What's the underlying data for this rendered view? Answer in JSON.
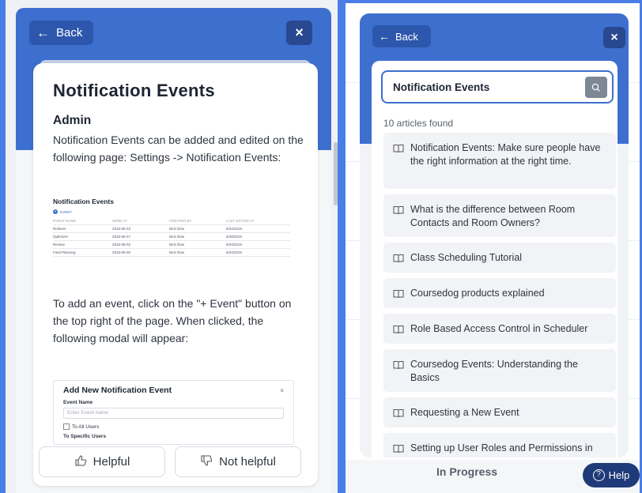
{
  "left": {
    "back_label": "Back",
    "close_icon": "×",
    "article": {
      "title": "Notification Events",
      "section": "Admin",
      "para1": "Notification Events can be added and edited on the following page: Settings -> Notification Events:",
      "table": {
        "title": "Notification Events",
        "add_label": "EVENT",
        "headers": [
          "EVENT NAME",
          "SEND AT",
          "CREATED BY",
          "LAST EDITED AT"
        ],
        "rows": [
          [
            "Rollover",
            "2018-06-23",
            "Nick Dias",
            "6/24/2019"
          ],
          [
            "Optimizer",
            "2018-06-27",
            "Nick Dias",
            "6/28/2019"
          ],
          [
            "Review",
            "2018-06-02",
            "Nick Dias",
            "6/24/2019"
          ],
          [
            "Final Planning",
            "2018-06-30",
            "Nick Dias",
            "6/24/2019"
          ]
        ]
      },
      "para2": "To add an event, click on the \"+ Event\" button on the top right of the page. When clicked, the following modal will appear:",
      "modal": {
        "title": "Add New Notification Event",
        "name_label": "Event Name",
        "name_placeholder": "Enter Event name",
        "all_users": "To All Users",
        "specific_users": "To Specific Users"
      }
    },
    "helpful_label": "Helpful",
    "not_helpful_label": "Not helpful"
  },
  "right": {
    "back_label": "Back",
    "close_icon": "×",
    "search_value": "Notification Events",
    "count_text": "10 articles found",
    "results": [
      "Notification Events: Make sure people have the right information at the right time.",
      "What is the difference between Room Contacts and Room Owners?",
      "Class Scheduling Tutorial",
      "Coursedog products explained",
      "Role Based Access Control in Scheduler",
      "Coursedog Events: Understanding the Basics",
      "Requesting a New Event",
      "Setting up User Roles and Permissions in"
    ],
    "status_text": "In Progress",
    "help_label": "Help"
  },
  "colors": {
    "brand_blue": "#3d6fcf",
    "back_button": "#2d57ac",
    "help_button": "#1f3a78"
  },
  "icons": [
    "arrow-left-icon",
    "close-icon",
    "thumbs-up-icon",
    "thumbs-down-icon",
    "search-icon",
    "book-icon",
    "question-circle-icon"
  ]
}
